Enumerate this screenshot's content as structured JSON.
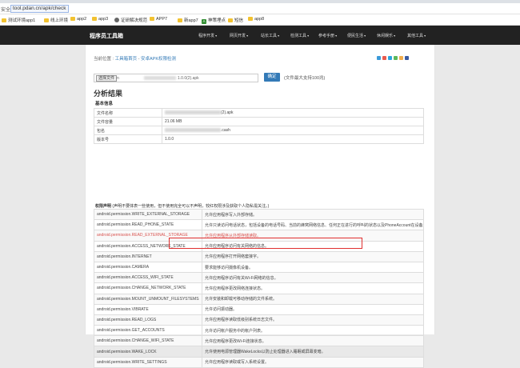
{
  "browser": {
    "security_label": "安全",
    "url": "tool.pdan.cn/apk/check",
    "bookmarks": [
      "测试环境app1",
      "线上环境",
      "app2",
      "app3",
      "证研解决规范",
      "APP7",
      "新app7",
      "神策埋点",
      "短信",
      "app8"
    ]
  },
  "site": {
    "logo": "程序员工具箱",
    "nav": [
      "程序开发",
      "网页开发",
      "站长工具",
      "检测工具",
      "参考手册",
      "便民生活",
      "休闲娱乐",
      "其他工具"
    ]
  },
  "breadcrumb": {
    "prefix": "当前位置 : ",
    "home": "工具箱首页",
    "sep": " - ",
    "current": "安卓APK权限检测"
  },
  "upload": {
    "choose_label": "选择文件",
    "file_prefix": "n",
    "file_suffix": "1.0.0(2).apk",
    "confirm_label": "确定",
    "max_size": "(文件最大支持100兆)"
  },
  "result": {
    "title": "分析结果",
    "basic_title": "基本信息",
    "rows": [
      {
        "key": "文件名称",
        "value": "(2).apk"
      },
      {
        "key": "文件容量",
        "value": "21.06 MB"
      },
      {
        "key": "包名",
        "value": ".cash"
      },
      {
        "key": "版本号",
        "value": "1.0.0"
      }
    ]
  },
  "permissions": {
    "title": "权限声明",
    "note": "(声明不要体表一些使用，但不使用完全可以不声明，较红权限涉及获取个人隐私需关注。)",
    "highlight_index": 2,
    "rows": [
      {
        "name": "android.permission.WRITE_EXTERNAL_STORAGE",
        "desc": "允许应用程序写入外部存储。"
      },
      {
        "name": "android.permission.READ_PHONE_STATE",
        "desc": "允许只读访问电话状态，包括设备的电话号码、当前的蜂窝网络信息、任何正在进行的呼叫的状态以及PhoneAccount在设备上注册的任何列表。"
      },
      {
        "name": "android.permission.READ_EXTERNAL_STORAGE",
        "desc": "允许应用程序从外部存储读取。"
      },
      {
        "name": "android.permission.ACCESS_NETWORK_STATE",
        "desc": "允许应用程序访问有关网络的信息。"
      },
      {
        "name": "android.permission.INTERNET",
        "desc": "允许应用程序打开网络套接字。"
      },
      {
        "name": "android.permission.CAMERA",
        "desc": "要求能够访问摄像机设备。"
      },
      {
        "name": "android.permission.ACCESS_WIFI_STATE",
        "desc": "允许应用程序访问有关Wi-Fi网络的信息。"
      },
      {
        "name": "android.permission.CHANGE_NETWORK_STATE",
        "desc": "允许应用程序更改网络连接状态。"
      },
      {
        "name": "android.permission.MOUNT_UNMOUNT_FILESYSTEMS",
        "desc": "允许安装和卸载可移动存储的文件系统。"
      },
      {
        "name": "android.permission.VIBRATE",
        "desc": "允许访问振动器。"
      },
      {
        "name": "android.permission.READ_LOGS",
        "desc": "允许应用程序读取低级别系统日志文件。"
      },
      {
        "name": "android.permission.GET_ACCOUNTS",
        "desc": "允许访问帐户服务中的帐户列表。"
      },
      {
        "name": "android.permission.CHANGE_WIFI_STATE",
        "desc": "允许应用程序更改Wi-Fi连接状态。"
      },
      {
        "name": "android.permission.WAKE_LOCK",
        "desc": "允许使用电源管理器WakeLocks以防止处理器进入睡眠或屏幕变暗。"
      },
      {
        "name": "android.permission.WRITE_SETTINGS",
        "desc": "允许应用程序读取或写入系统设置。"
      }
    ]
  },
  "colors": {
    "accent": "#337ab7",
    "nav_bg": "#222222",
    "highlight": "#e03030"
  }
}
